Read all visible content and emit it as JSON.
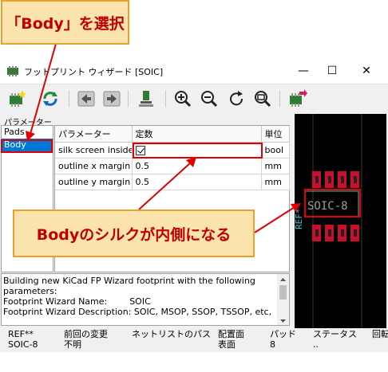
{
  "annotations": {
    "top_callout": "「Body」を選択",
    "mid_callout": "Bodyのシルクが内側になる"
  },
  "window": {
    "title": "フットプリント ウィザード [SOIC]",
    "minimize": "—",
    "maximize": "☐",
    "close": "✕"
  },
  "toolbar": {
    "icons": [
      "select-wizard-icon",
      "refresh-icon",
      "previous-icon",
      "next-icon",
      "footprint-icon",
      "zoom-in-icon",
      "zoom-out-icon",
      "redraw-icon",
      "zoom-fit-icon",
      "export-icon"
    ]
  },
  "section_label": "パラメーター",
  "pages": [
    "Pads",
    "Body"
  ],
  "selected_page": "Body",
  "params": {
    "headers": [
      "パラメーター",
      "定数",
      "単位"
    ],
    "rows": [
      {
        "name": "silk screen inside",
        "value": "",
        "checked": true,
        "unit": "bool"
      },
      {
        "name": "outline x margin",
        "value": "0.5",
        "unit": "mm"
      },
      {
        "name": "outline y margin",
        "value": "0.5",
        "unit": "mm"
      }
    ]
  },
  "preview": {
    "ref_text": "REF**",
    "value_text": "SOIC-8",
    "colors": {
      "pad": "#c8102e",
      "silk": "#4db8c8",
      "background": "#000000"
    }
  },
  "messages": [
    "Building new KiCad FP Wizard footprint with the following",
    "parameters:",
    "Footprint Wizard Name:        SOIC",
    "Footprint Wizard Description: SOIC, MSOP, SSOP, TSSOP, etc,"
  ],
  "status_bar": [
    {
      "label": "REF**",
      "value": "SOIC-8"
    },
    {
      "label": "前回の変更",
      "value": "不明"
    },
    {
      "label": "ネットリストのパス",
      "value": ""
    },
    {
      "label": "配置面",
      "value": "表面"
    },
    {
      "label": "パッド",
      "value": "8"
    },
    {
      "label": "ステータス",
      "value": ".."
    },
    {
      "label": "回転",
      "value": ""
    }
  ]
}
